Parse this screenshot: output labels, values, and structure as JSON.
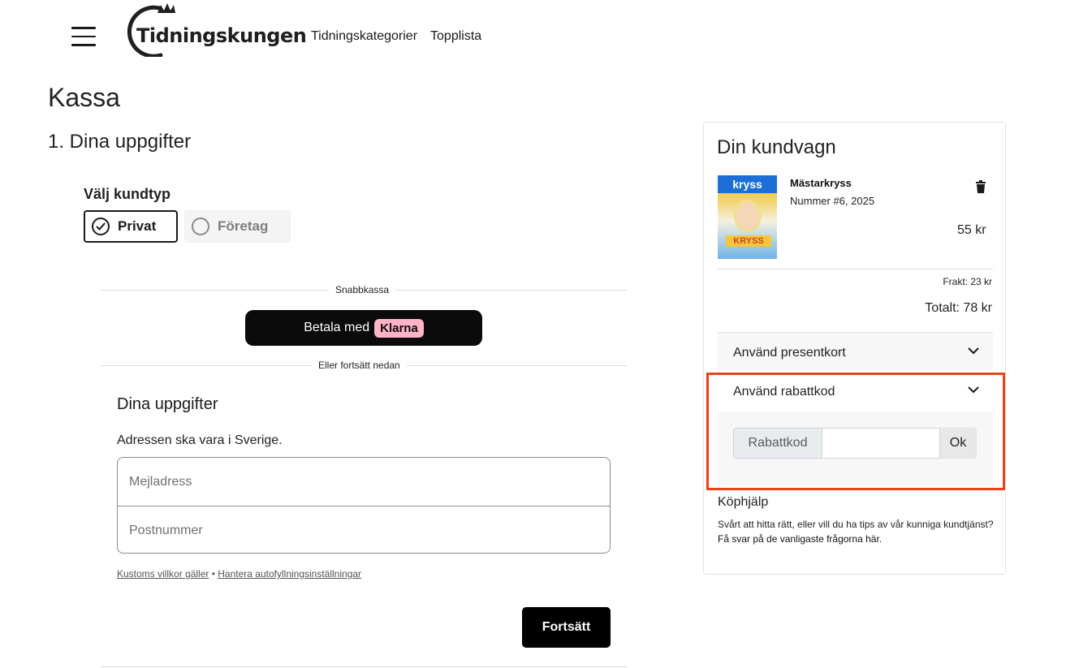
{
  "header": {
    "logo_text": "Tidningskungen",
    "nav": [
      "Tidningskategorier",
      "Topplista"
    ]
  },
  "page": {
    "title": "Kassa",
    "step_title": "1. Dina uppgifter"
  },
  "customer_type": {
    "label": "Välj kundtyp",
    "options": [
      {
        "label": "Privat",
        "selected": true
      },
      {
        "label": "Företag",
        "selected": false
      }
    ]
  },
  "express": {
    "divider_label": "Snabbkassa",
    "klarna_prefix": "Betala med",
    "klarna_brand": "Klarna",
    "continue_divider": "Eller fortsätt nedan"
  },
  "form": {
    "title": "Dina uppgifter",
    "note": "Adressen ska vara i Sverige.",
    "email_placeholder": "Mejladress",
    "postcode_placeholder": "Postnummer",
    "terms_link": "Kustoms villkor gäller",
    "separator": "•",
    "autofill_link": "Hantera autofyllningsinställningar",
    "continue_label": "Fortsätt"
  },
  "cart": {
    "title": "Din kundvagn",
    "items": [
      {
        "name": "Mästarkryss",
        "issue": "Nummer #6, 2025",
        "price": "55 kr",
        "cover_masthead": "kryss",
        "cover_subtitle": "KRYSS"
      }
    ],
    "shipping": "Frakt: 23 kr",
    "total": "Totalt: 78 kr",
    "gift_card_label": "Använd presentkort",
    "discount_label": "Använd rabattkod",
    "discount_input_label": "Rabattkod",
    "discount_input_value": "",
    "discount_ok": "Ok",
    "help_title": "Köphjälp",
    "help_text": "Svårt att hitta rätt, eller vill du ha tips av vår kunniga kundtjänst?",
    "help_link": "Få svar på de vanligaste frågorna här."
  },
  "colors": {
    "highlight": "#e8441b",
    "klarna_pink": "#ffb3c7",
    "button_black": "#000000"
  }
}
